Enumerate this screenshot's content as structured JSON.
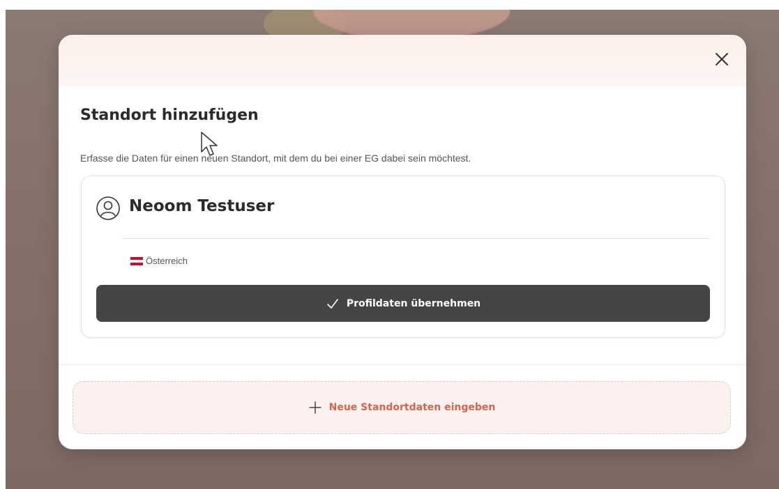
{
  "modal": {
    "title": "Standort hinzufügen",
    "subtitle": "Erfasse die Daten für einen neuen Standort, mit dem du bei einer EG dabei sein möchtest.",
    "close_icon": "close-icon"
  },
  "profile": {
    "avatar_icon": "user-circle-icon",
    "name": "Neoom Testuser",
    "country": "Österreich",
    "flag_icon": "austria-flag-icon",
    "apply_icon": "check-icon",
    "apply_label": "Profildaten übernehmen"
  },
  "footer": {
    "add_icon": "plus-icon",
    "new_location_label": "Neue Standortdaten eingeben"
  },
  "colors": {
    "apply_button_bg": "#454545",
    "accent": "#d1654f",
    "overlay": "#857069",
    "header_tint": "#fbefeb"
  }
}
